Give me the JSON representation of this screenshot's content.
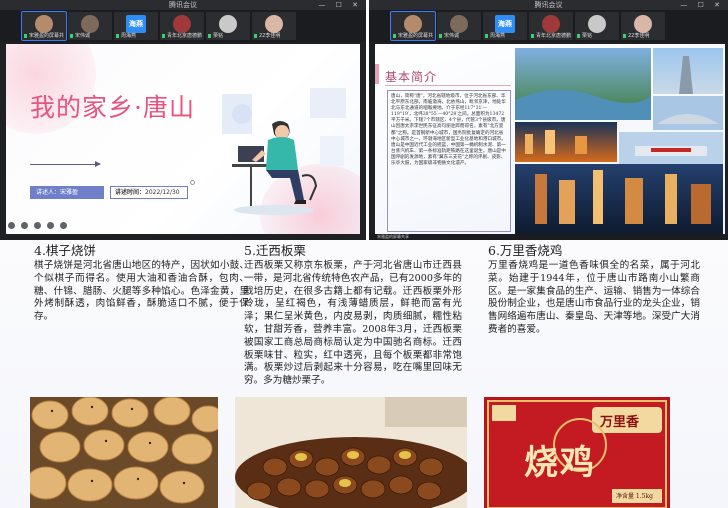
{
  "window_title": "腾讯会议",
  "window_controls": "— ☐ ✕",
  "left_participants": [
    {
      "name": "宋雅盈的屏幕共享",
      "color": "#b58b6e"
    },
    {
      "name": "宋伟诚",
      "color": "#7d6a5a"
    },
    {
      "name": "周海燕",
      "badge": "海燕",
      "color": "#2f8ef5"
    },
    {
      "name": "青年北京唐德鹏",
      "color": "#a03a3a"
    },
    {
      "name": "栗铭",
      "color": "#c9c9c9"
    },
    {
      "name": "22李佳明",
      "color": "#d9b7a6"
    }
  ],
  "right_participants": [
    {
      "name": "宋雅盈的屏幕共享",
      "color": "#b58b6e"
    },
    {
      "name": "宋伟诚",
      "color": "#7d6a5a"
    },
    {
      "name": "周海燕",
      "badge": "海燕",
      "color": "#2f8ef5"
    },
    {
      "name": "青年北京唐德鹏",
      "color": "#a03a3a"
    },
    {
      "name": "栗铭",
      "color": "#c9c9c9"
    },
    {
      "name": "22李佳明",
      "color": "#d9b7a6"
    }
  ],
  "slide1": {
    "title": "我的家乡·唐山",
    "speaker": "讲述人：宋雅盈",
    "date_label": "讲述时间：",
    "date_value": "2022/12/30"
  },
  "slide2": {
    "header": "基本简介",
    "body": "唐山，简称\"唐\"，河北省辖地级市，位于河北省东部、华北平原东北部，南临渤海，北依燕山，毗邻京津，地处华北与东北通道的咽喉要地。介于东经117°31′—119°19′，北纬38°55′—40°28′之间。总面积为13472平方千米。下辖7个市辖区、4个县，代管3个县级市。唐山因唐太宗李世民东征高句丽驻跸而得名，素有\"北方瓷都\"之称。是首钢新中心城市，国务院批复确定的河北省中心城市之一，环渤海地区新型工业化基地和港口城市。唐山是中国近代工业的摇篮，中国第一桶机制水泥、第一台蒸汽机车、第一条标准轨距铁路在这里诞生。唐山是中国评剧的发源地，素有\"冀东三支花\"之称的评剧、皮影、乐亭大鼓，为国家级非物质文化遗产。",
    "share_label": "宋雅盈的屏幕共享"
  },
  "sections": [
    {
      "title": "4.棋子烧饼",
      "body": "棋子烧饼是河北省唐山地区的特产，因状如小鼓、个似棋子而得名。使用大油和香油合酥，包肉、糖、什锦、腊肠、火腿等多种馅心。色泽金黄，里外烤制酥透，肉馅鲜香，酥脆适口不腻，便于保存。"
    },
    {
      "title": "5.迁西板栗",
      "body": "迁西板栗又称京东板栗，产于河北省唐山市迁西县一带，是河北省传统特色农产品，已有2000多年的栽培历史，在很多古籍上都有记载。迁西板栗外形玲珑，呈红褐色，有浅薄蜡质层，鲜艳而富有光泽；果仁呈米黄色，内皮易剥，肉质细腻，糯性粘软，甘甜芳香，营养丰富。2008年3月，迁西板栗被国家工商总局商标局认定为中国驰名商标。迁西板栗味甘、粒实，红中透亮，且每个板栗都非常饱满。板栗炒过后剥起来十分容易，吃在嘴里回味无穷。多为糖炒栗子。"
    },
    {
      "title": "6.万里香烧鸡",
      "body": "万里香烧鸡是一道色香味俱全的名菜，属于河北菜。始建于1944年，位于唐山市路南小山繁商区。是一家集食品的生产、运输、销售为一体综合股份制企业，也是唐山市食品行业的龙头企业，销售网络遍布唐山、秦皇岛、天津等地。深受广大消费者的喜爱。"
    }
  ],
  "package": {
    "brand": "万里香",
    "big_text": "烧鸡",
    "weight": "净含量 1.5kg"
  }
}
